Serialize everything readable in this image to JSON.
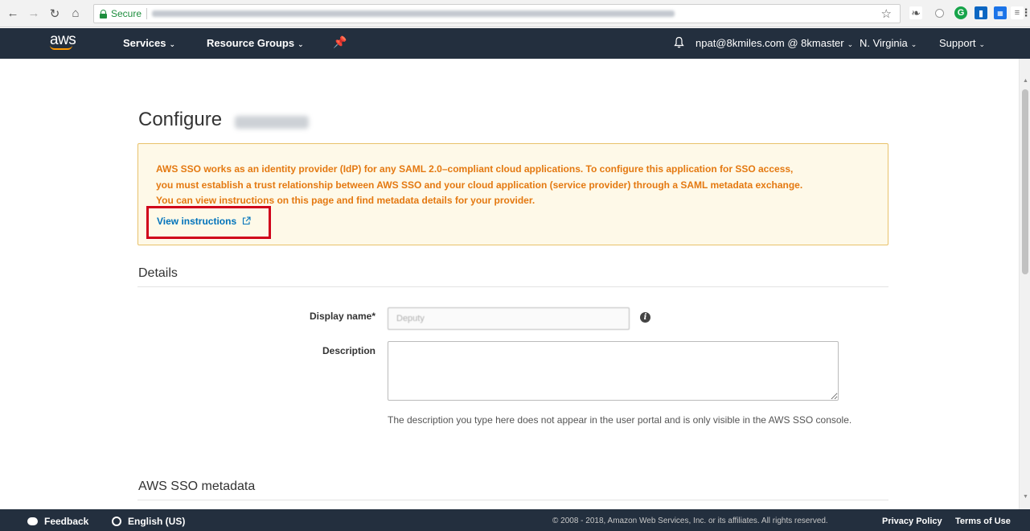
{
  "browser": {
    "secure_label": "Secure",
    "icons": [
      "back-icon",
      "forward-icon",
      "reload-icon",
      "home-icon",
      "lock-icon",
      "star-icon",
      "menu-icon"
    ]
  },
  "topnav": {
    "logo": "aws",
    "services": "Services",
    "resource_groups": "Resource Groups",
    "account": "npat@8kmiles.com @ 8kmaster",
    "region": "N. Virginia",
    "support": "Support"
  },
  "page": {
    "title": "Configure",
    "alert": {
      "line1": "AWS SSO works as an identity provider (IdP) for any SAML 2.0–compliant cloud applications. To configure this application for SSO access,",
      "line2": "you must establish a trust relationship between AWS SSO and your cloud application (service provider) through a SAML metadata exchange.",
      "line3": "You can view instructions on this page and find metadata details for your provider.",
      "link": "View instructions"
    },
    "details_heading": "Details",
    "display_name_label": "Display name*",
    "display_name_value": "Deputy",
    "description_label": "Description",
    "description_help": "The description you type here does not appear in the user portal and is only visible in the AWS SSO console.",
    "metadata_heading": "AWS SSO metadata"
  },
  "footer": {
    "feedback": "Feedback",
    "language": "English (US)",
    "copyright": "© 2008 - 2018, Amazon Web Services, Inc. or its affiliates. All rights reserved.",
    "privacy": "Privacy Policy",
    "terms": "Terms of Use"
  },
  "colors": {
    "nav_bg": "#232f3e",
    "alert_bg": "#fef9e8",
    "alert_border": "#e8c26b",
    "alert_text": "#e47911",
    "link": "#0073bb",
    "highlight_box": "#d0021b",
    "aws_orange": "#ff9900"
  }
}
